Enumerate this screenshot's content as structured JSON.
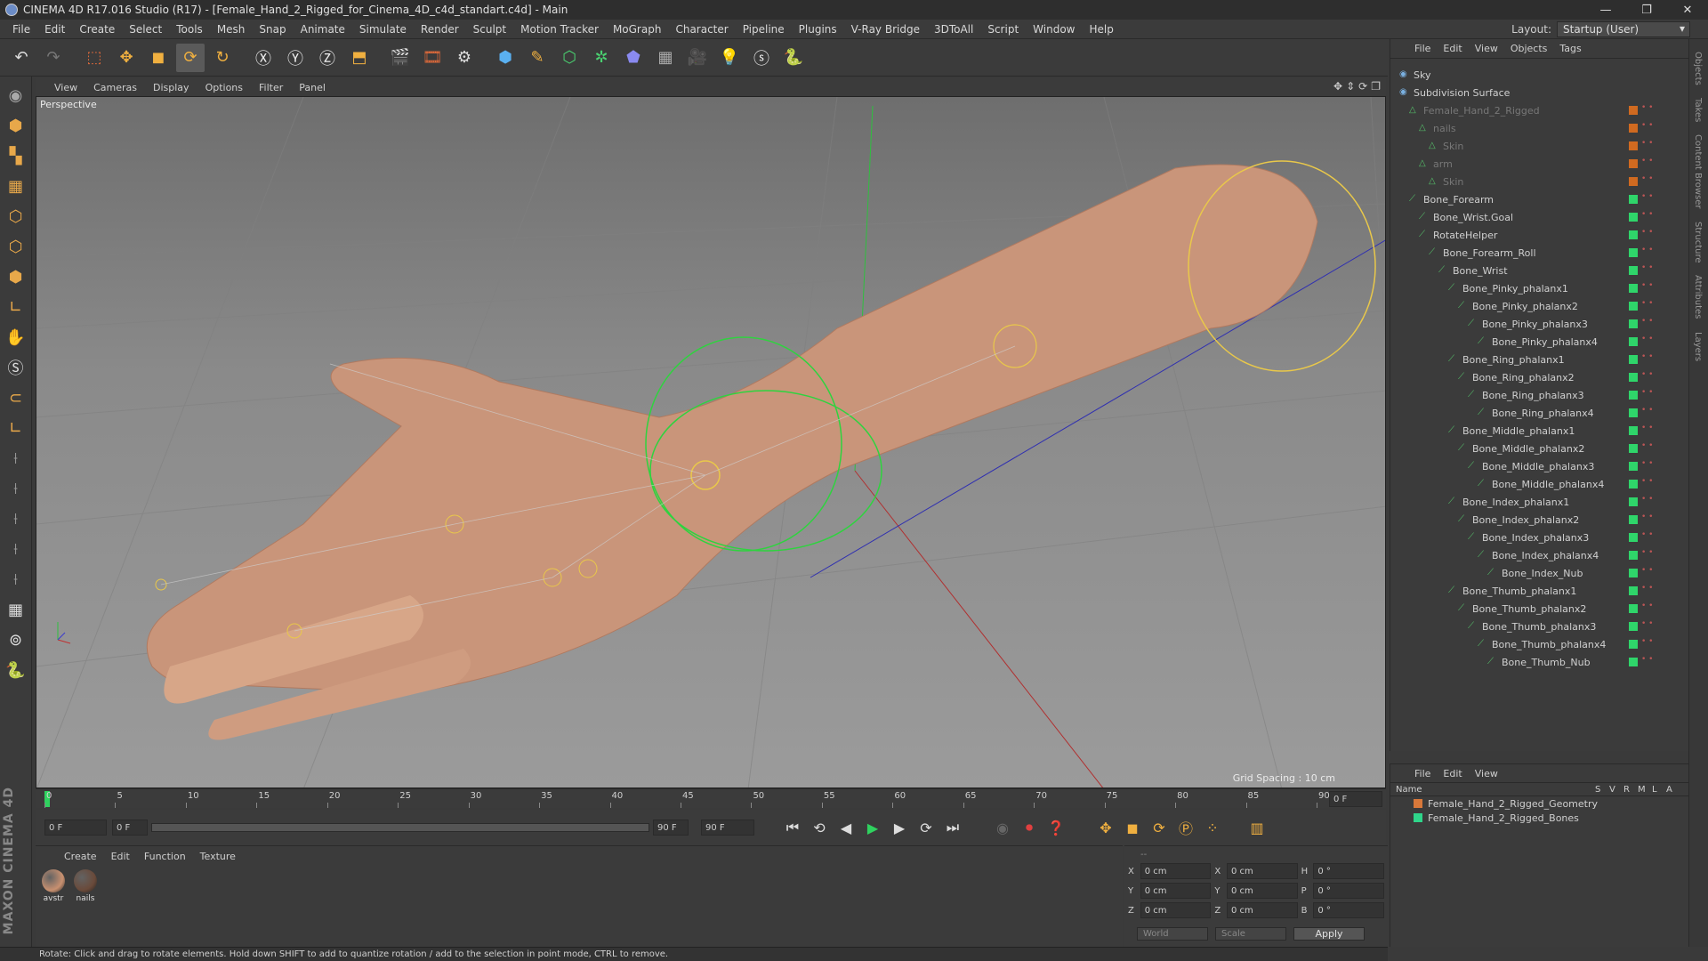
{
  "window": {
    "title": "CINEMA 4D R17.016 Studio (R17) - [Female_Hand_2_Rigged_for_Cinema_4D_c4d_standart.c4d] - Main",
    "controls": [
      "—",
      "❐",
      "✕"
    ]
  },
  "menubar": [
    "File",
    "Edit",
    "Create",
    "Select",
    "Tools",
    "Mesh",
    "Snap",
    "Animate",
    "Simulate",
    "Render",
    "Sculpt",
    "Motion Tracker",
    "MoGraph",
    "Character",
    "Pipeline",
    "Plugins",
    "V-Ray Bridge",
    "3DToAll",
    "Script",
    "Window",
    "Help"
  ],
  "layout": {
    "label": "Layout:",
    "value": "Startup (User)"
  },
  "viewport": {
    "menu": [
      "View",
      "Cameras",
      "Display",
      "Options",
      "Filter",
      "Panel"
    ],
    "name": "Perspective",
    "grid_spacing": "Grid Spacing : 10 cm"
  },
  "timeline": {
    "ticks": [
      "0",
      "5",
      "10",
      "15",
      "20",
      "25",
      "30",
      "35",
      "40",
      "45",
      "50",
      "55",
      "60",
      "65",
      "70",
      "75",
      "80",
      "85",
      "90"
    ],
    "end_field": "0 F"
  },
  "transport": {
    "current_frame": "0 F",
    "range_start": "0 F",
    "range_end": "90 F",
    "max_frame": "90 F"
  },
  "materials": {
    "menu": [
      "Create",
      "Edit",
      "Function",
      "Texture"
    ],
    "items": [
      {
        "label": "avstr",
        "color": "#c89070"
      },
      {
        "label": "nails",
        "color": "#6a4a3a"
      }
    ]
  },
  "coords": {
    "rows": [
      {
        "a1": "X",
        "v1": "0 cm",
        "a2": "X",
        "v2": "0 cm",
        "a3": "H",
        "v3": "0 °"
      },
      {
        "a1": "Y",
        "v1": "0 cm",
        "a2": "Y",
        "v2": "0 cm",
        "a3": "P",
        "v3": "0 °"
      },
      {
        "a1": "Z",
        "v1": "0 cm",
        "a2": "Z",
        "v2": "0 cm",
        "a3": "B",
        "v3": "0 °"
      }
    ],
    "world": "World",
    "scale": "Scale",
    "apply": "Apply",
    "header_dash": "--"
  },
  "status": "Rotate: Click and drag to rotate elements. Hold down SHIFT to add to quantize rotation / add to the selection in point mode, CTRL to remove.",
  "objects": {
    "menu": [
      "File",
      "Edit",
      "View",
      "Objects",
      "Tags"
    ],
    "items": [
      "Sky",
      "Subdivision Surface",
      "Female_Hand_2_Rigged",
      "nails",
      "Skin",
      "arm",
      "Skin",
      "Bone_Forearm",
      "Bone_Wrist.Goal",
      "RotateHelper",
      "Bone_Forearm_Roll",
      "Bone_Wrist",
      "Bone_Pinky_phalanx1",
      "Bone_Pinky_phalanx2",
      "Bone_Pinky_phalanx3",
      "Bone_Pinky_phalanx4",
      "Bone_Ring_phalanx1",
      "Bone_Ring_phalanx2",
      "Bone_Ring_phalanx3",
      "Bone_Ring_phalanx4",
      "Bone_Middle_phalanx1",
      "Bone_Middle_phalanx2",
      "Bone_Middle_phalanx3",
      "Bone_Middle_phalanx4",
      "Bone_Index_phalanx1",
      "Bone_Index_phalanx2",
      "Bone_Index_phalanx3",
      "Bone_Index_phalanx4",
      "Bone_Index_Nub",
      "Bone_Thumb_phalanx1",
      "Bone_Thumb_phalanx2",
      "Bone_Thumb_phalanx3",
      "Bone_Thumb_phalanx4",
      "Bone_Thumb_Nub"
    ]
  },
  "sidetabs": [
    "Objects",
    "Takes",
    "Content Browser",
    "Structure",
    "Attributes",
    "Layers"
  ],
  "layers": {
    "menu": [
      "File",
      "Edit",
      "View"
    ],
    "header": {
      "name": "Name",
      "cols": [
        "S",
        "V",
        "R",
        "M",
        "L",
        "A"
      ]
    },
    "items": [
      {
        "name": "Female_Hand_2_Rigged_Geometry",
        "color": "#d8783a"
      },
      {
        "name": "Female_Hand_2_Rigged_Bones",
        "color": "#2fd58a"
      }
    ]
  }
}
